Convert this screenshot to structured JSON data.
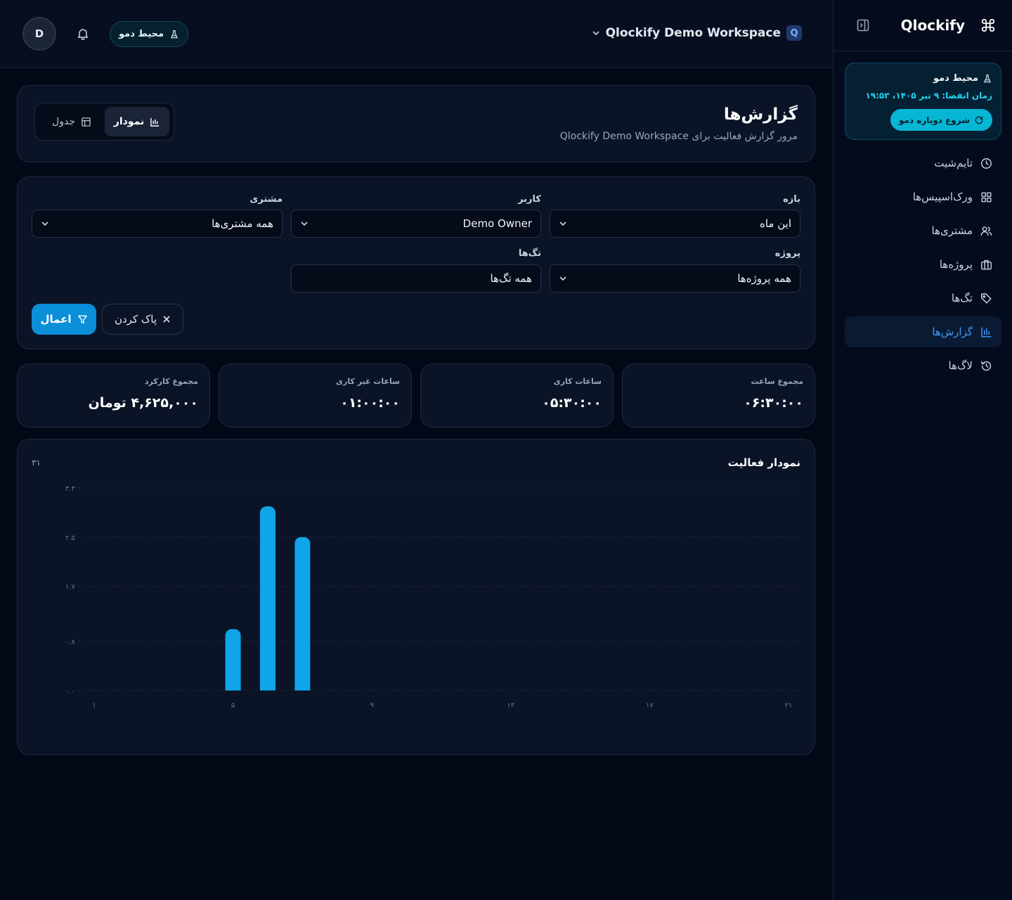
{
  "brand": {
    "name": "Qlockify"
  },
  "demo_card": {
    "title": "محیط دمو",
    "expire": "زمان انقضا: ۹ تیر ۱۴۰۵، ۱۹:۵۳",
    "restart_label": "شروع دوباره دمو"
  },
  "nav": [
    {
      "label": "تایم‌شیت",
      "icon": "clock-icon"
    },
    {
      "label": "ورک‌اسپیس‌ها",
      "icon": "grid-icon"
    },
    {
      "label": "مشتری‌ها",
      "icon": "users-icon"
    },
    {
      "label": "پروژه‌ها",
      "icon": "briefcase-icon"
    },
    {
      "label": "تگ‌ها",
      "icon": "tag-icon"
    },
    {
      "label": "گزارش‌ها",
      "icon": "bar-chart-icon",
      "active": true
    },
    {
      "label": "لاگ‌ها",
      "icon": "history-icon"
    }
  ],
  "header": {
    "avatar_initial": "D",
    "demo_pill": "محیط دمو",
    "workspace_name": "Qlockify Demo Workspace",
    "workspace_badge": "Q"
  },
  "page": {
    "title": "گزارش‌ها",
    "subtitle": "مرور گزارش فعالیت برای Qlockify Demo Workspace",
    "view_chart": "نمودار",
    "view_table": "جدول"
  },
  "filters": {
    "range_label": "بازه",
    "range_value": "این ماه",
    "user_label": "کاربر",
    "user_value": "Demo Owner",
    "client_label": "مشتری",
    "client_value": "همه مشتری‌ها",
    "project_label": "پروژه",
    "project_value": "همه پروژه‌ها",
    "tags_label": "تگ‌ها",
    "tags_value": "همه تگ‌ها",
    "apply_label": "اعمال",
    "clear_label": "پاک کردن"
  },
  "stats": [
    {
      "label": "مجموع ساعت",
      "value": "۰۶:۳۰:۰۰"
    },
    {
      "label": "ساعات کاری",
      "value": "۰۵:۳۰:۰۰"
    },
    {
      "label": "ساعات غیر کاری",
      "value": "۰۱:۰۰:۰۰"
    },
    {
      "label": "مجموع کارکرد",
      "value": "۴,۶۲۵,۰۰۰ تومان"
    }
  ],
  "chart": {
    "title": "نمودار فعالیت",
    "count": "۳۱"
  },
  "colors": {
    "accent": "#0ea5e9",
    "bar": "#0ea5e9",
    "demo": "#06b6d4"
  },
  "chart_data": {
    "type": "bar",
    "x_ticks": [
      1,
      5,
      9,
      13,
      17,
      21
    ],
    "x_tick_labels": [
      "۱",
      "۵",
      "۹",
      "۱۳",
      "۱۷",
      "۲۱"
    ],
    "y_ticks": [
      0,
      0.8,
      1.7,
      2.5,
      3.3
    ],
    "y_tick_labels": [
      "۰.۰",
      "۰.۸",
      "۱.۷",
      "۲.۵",
      "۳.۳"
    ],
    "ylim": [
      0,
      3.3
    ],
    "x_range": [
      1,
      21
    ],
    "bars": [
      {
        "day": 5,
        "value": 1.0
      },
      {
        "day": 6,
        "value": 3.0
      },
      {
        "day": 7,
        "value": 2.5
      }
    ],
    "grid": true
  }
}
